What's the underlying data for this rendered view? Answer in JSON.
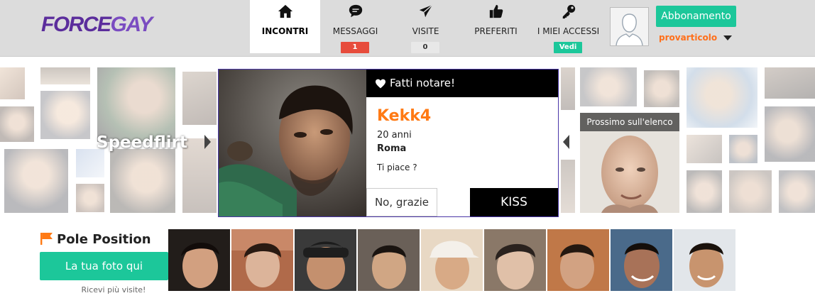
{
  "logo": {
    "part1": "FORCE",
    "part2": "GAY"
  },
  "nav": [
    {
      "label": "INCONTRI",
      "icon": "home-icon",
      "active": true
    },
    {
      "label": "MESSAGGI",
      "icon": "chat-bubble-icon",
      "badge": "1",
      "badge_color": "#e74c3c"
    },
    {
      "label": "VISITE",
      "icon": "paper-plane-icon",
      "badge": "0",
      "badge_color": "#e8e8e8"
    },
    {
      "label": "PREFERITI",
      "icon": "thumbs-up-icon"
    },
    {
      "label": "I MIEI ACCESSI",
      "icon": "key-icon",
      "badge": "Vedi",
      "badge_color": "#1cc79a"
    }
  ],
  "user": {
    "name": "provarticolo",
    "subscribe_label": "Abbonamento"
  },
  "speedflirt": {
    "label": "Speedflirt",
    "card": {
      "header": "Fatti notare!",
      "name": "Kekk4",
      "age": "20 anni",
      "city": "Roma",
      "question": "Ti piace ?",
      "no_label": "No, grazie",
      "kiss_label": "KISS"
    },
    "next_label": "Prossimo sull'elenco"
  },
  "pole": {
    "title": "Pole Position",
    "button": "La tua foto qui",
    "subtitle": "Ricevi più visite!",
    "thumb_count": 9
  },
  "colors": {
    "brand_purple": "#5b2d9c",
    "accent_green": "#1cc79a",
    "accent_orange": "#ff7a14",
    "badge_red": "#e74c3c"
  }
}
